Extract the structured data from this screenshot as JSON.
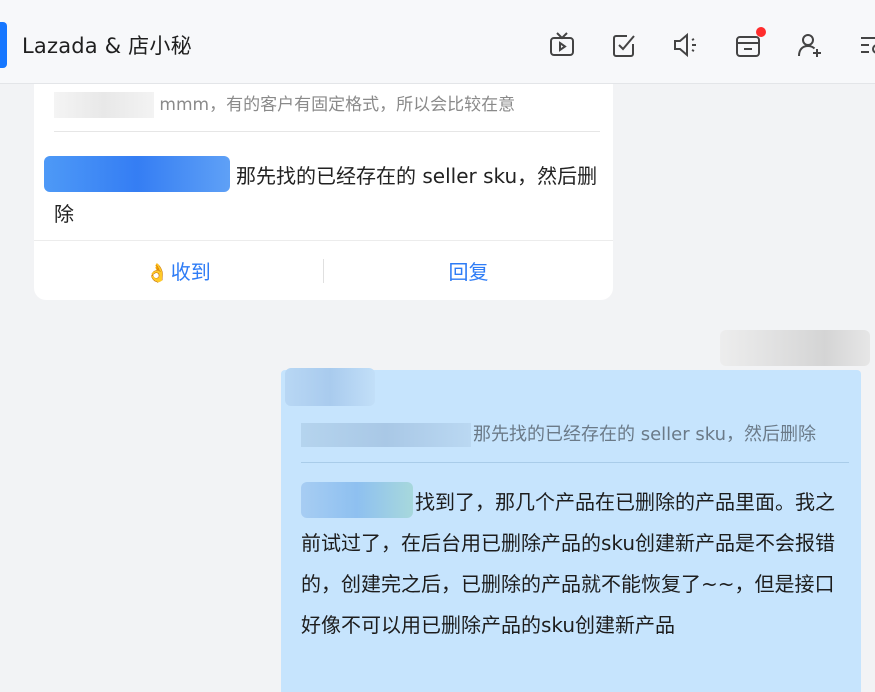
{
  "header": {
    "title": "Lazada & 店小秘",
    "toolbar_icons": [
      "tv-icon",
      "checklist-icon",
      "speaker-icon",
      "minus-box-icon",
      "add-user-icon",
      "more-list-icon"
    ],
    "notification_dot_color": "#ff2d2d",
    "accent_color": "#1677ff"
  },
  "incoming": {
    "quote_text": "mmm，有的客户有固定格式，所以会比较在意",
    "message_text": "那先找的已经存在的  seller sku，然后删除",
    "actions": {
      "received_label": "收到",
      "received_icon": "👌",
      "reply_label": "回复"
    }
  },
  "outgoing": {
    "quote_text": "那先找的已经存在的  seller sku，然后删除",
    "message_text": "找到了，那几个产品在已删除的产品里面。我之前试过了，在后台用已删除产品的sku创建新产品是不会报错的，创建完之后，已删除的产品就不能恢复了~~，但是接口好像不可以用已删除产品的sku创建新产品",
    "bubble_color": "#c6e4fd"
  },
  "colors": {
    "link_blue": "#2e7cf6"
  }
}
